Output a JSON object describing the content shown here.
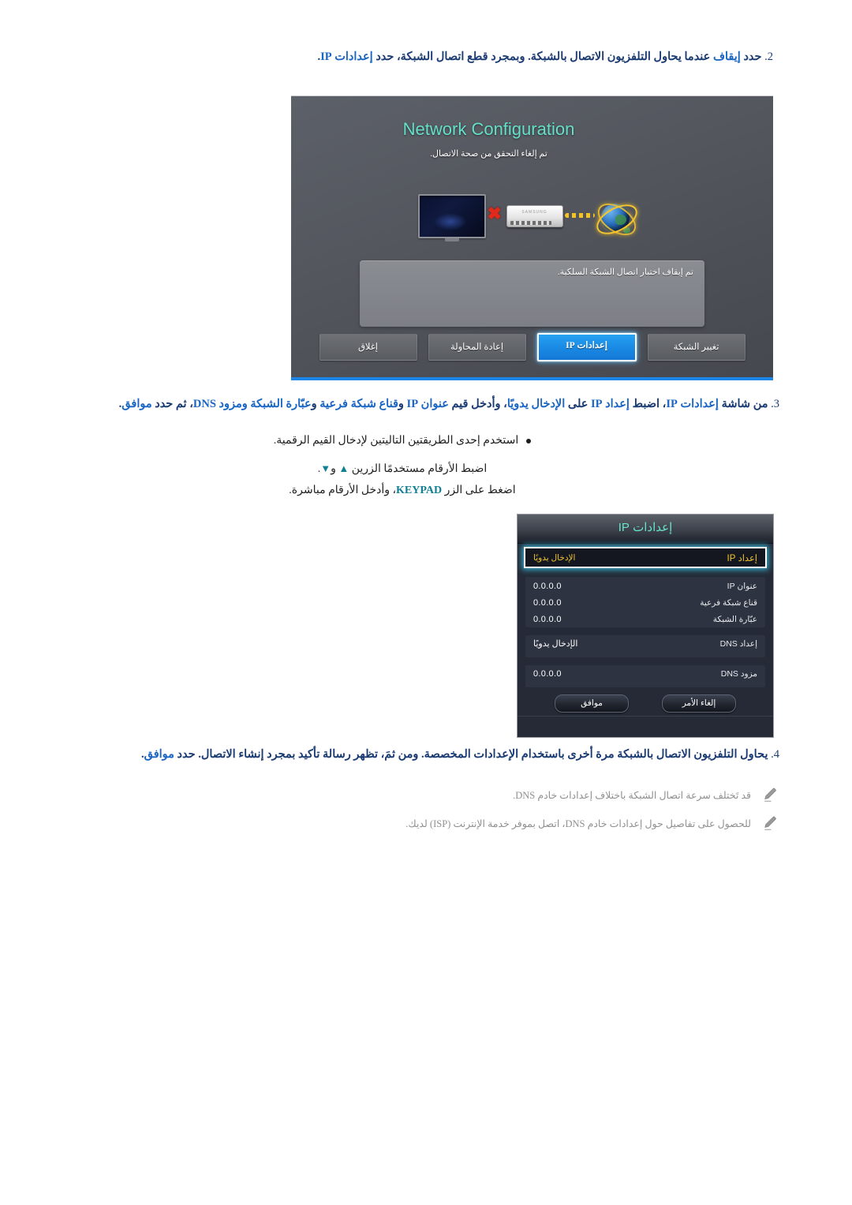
{
  "steps": [
    {
      "number": "2.",
      "segments": [
        {
          "t": "حدد ",
          "hl": false
        },
        {
          "t": "إيقاف",
          "hl": true
        },
        {
          "t": " عندما يحاول التلفزيون الاتصال بالشبكة. وبمجرد قطع اتصال الشبكة، حدد ",
          "hl": false
        },
        {
          "t": "إعدادات IP",
          "hl": true
        },
        {
          "t": ".",
          "hl": false
        }
      ]
    },
    {
      "number": "3.",
      "segments": [
        {
          "t": "من شاشة ",
          "hl": false
        },
        {
          "t": "إعدادات IP",
          "hl": true
        },
        {
          "t": "، اضبط ",
          "hl": false
        },
        {
          "t": "إعداد IP",
          "hl": true
        },
        {
          "t": " على ",
          "hl": false
        },
        {
          "t": "الإدخال يدويًا",
          "hl": true
        },
        {
          "t": "، وأدخل قيم ",
          "hl": false
        },
        {
          "t": "عنوان IP",
          "hl": true
        },
        {
          "t": " و",
          "hl": false
        },
        {
          "t": "قناع شبكة فرعية",
          "hl": true
        },
        {
          "t": " و",
          "hl": false
        },
        {
          "t": "عبّارة الشبكة ومزود DNS",
          "hl": true
        },
        {
          "t": "، ثم حدد ",
          "hl": false
        },
        {
          "t": "موافق",
          "hl": true
        },
        {
          "t": ".",
          "hl": false
        }
      ]
    },
    {
      "number": "4.",
      "segments": [
        {
          "t": "يحاول التلفزيون الاتصال بالشبكة مرة أخرى باستخدام الإعدادات المخصصة. ومن ثمَ، تظهر رسالة تأكيد بمجرد إنشاء الاتصال. حدد ",
          "hl": false
        },
        {
          "t": "موافق",
          "hl": true
        },
        {
          "t": ".",
          "hl": false
        }
      ]
    }
  ],
  "sub_block": {
    "bullet": "استخدم إحدى الطريقتين التاليتين لإدخال القيم الرقمية.",
    "line_up_down_pre": "اضبط الأرقام مستخدمًا الزرين ",
    "arrow_up": "▲",
    "line_up_down_mid": " و",
    "arrow_down": "▼",
    "line_up_down_post": ".",
    "line_keypad_pre": "اضغط على الزر ",
    "keypad_label": "KEYPAD",
    "line_keypad_post": "، وأدخل الأرقام مباشرة."
  },
  "notes": [
    {
      "icon": "pencil-icon",
      "text": "قد تَختلف سرعة اتصال الشبكة باختلاف إعدادات خادم DNS."
    },
    {
      "icon": "pencil-icon",
      "text": "للحصول على تفاصيل حول إعدادات خادم DNS، اتصل بموفر خدمة الإنترنت (ISP) لديك."
    }
  ],
  "network_screen": {
    "title": "Network Configuration",
    "subtitle": "تم إلغاء التحقق من صحة الاتصال.",
    "message": "تم إيقاف اختبار اتصال الشبكة السلكية.",
    "diagram": {
      "tv_icon": "tv-icon",
      "error_mark": "x-error-icon",
      "router_icon": "router-icon",
      "router_brand": "SAMSUNG",
      "globe_icon": "globe-icon"
    },
    "buttons": [
      {
        "label": "تغيير الشبكة",
        "active": false,
        "name": "change-network-button"
      },
      {
        "label": "إعدادات IP",
        "active": true,
        "name": "ip-settings-button"
      },
      {
        "label": "إعادة المحاولة",
        "active": false,
        "name": "retry-button"
      },
      {
        "label": "إغلاق",
        "active": false,
        "name": "close-button"
      }
    ]
  },
  "ip_screen": {
    "title": "إعدادات IP",
    "selected_row": {
      "label": "إعداد IP",
      "value": "الإدخال يدويًا"
    },
    "group1": [
      {
        "label": "عنوان IP",
        "value": "0.0.0.0"
      },
      {
        "label": "قناع شبكة فرعية",
        "value": "0.0.0.0"
      },
      {
        "label": "عبّارة الشبكة",
        "value": "0.0.0.0"
      }
    ],
    "group2": [
      {
        "label": "إعداد DNS",
        "value": "الإدخال يدويًا"
      }
    ],
    "group3": [
      {
        "label": "مزود DNS",
        "value": "0.0.0.0"
      }
    ],
    "buttons": [
      {
        "label": "إلغاء الأمر",
        "name": "cancel-button"
      },
      {
        "label": "موافق",
        "name": "ok-button"
      }
    ]
  },
  "colors": {
    "step_text": "#1b3c73",
    "highlight": "#1a66c4",
    "teal": "#0f7f93",
    "net_title": "#64e0c8",
    "active_button": "#1a8be5",
    "ip_selected_text": "#f2c62e",
    "note_text": "#909090"
  }
}
